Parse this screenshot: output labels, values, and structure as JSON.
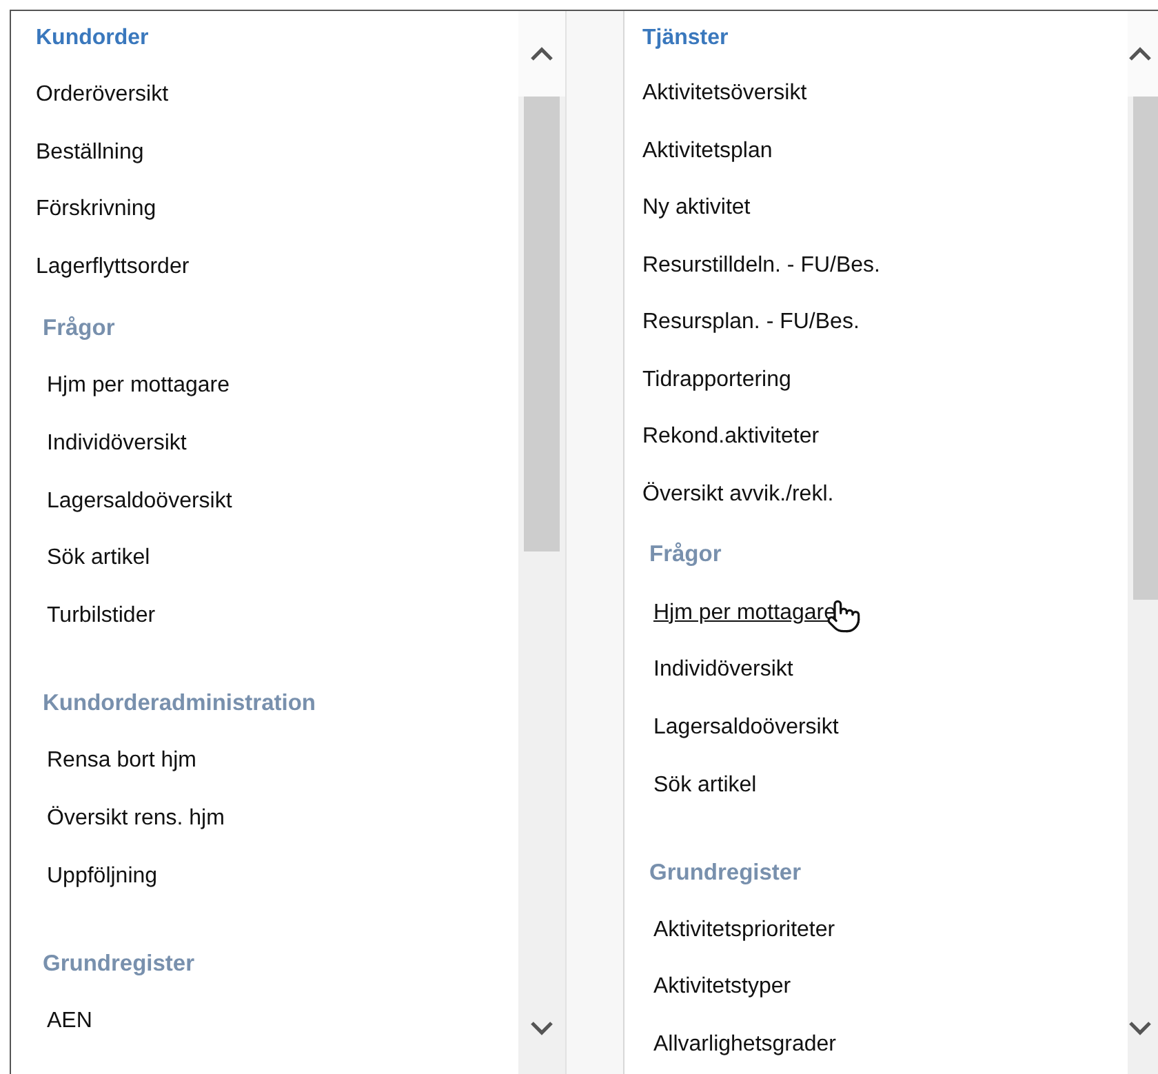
{
  "panels": [
    {
      "title": "Kundorder",
      "items": [
        {
          "label": "Orderöversikt",
          "hovered": false
        },
        {
          "label": "Beställning",
          "hovered": false
        },
        {
          "label": "Förskrivning",
          "hovered": false
        },
        {
          "label": "Lagerflyttsorder",
          "hovered": false
        }
      ],
      "groups": [
        {
          "title": "Frågor",
          "items": [
            {
              "label": "Hjm per mottagare",
              "hovered": false
            },
            {
              "label": "Individöversikt",
              "hovered": false
            },
            {
              "label": "Lagersaldoöversikt",
              "hovered": false
            },
            {
              "label": "Sök artikel",
              "hovered": false
            },
            {
              "label": "Turbilstider",
              "hovered": false
            }
          ]
        },
        {
          "title": "Kundorderadministration",
          "items": [
            {
              "label": "Rensa bort hjm",
              "hovered": false
            },
            {
              "label": "Översikt rens. hjm",
              "hovered": false
            },
            {
              "label": "Uppföljning",
              "hovered": false
            }
          ]
        },
        {
          "title": "Grundregister",
          "items": [
            {
              "label": "AEN",
              "hovered": false
            }
          ]
        }
      ]
    },
    {
      "title": "Tjänster",
      "items": [
        {
          "label": "Aktivitetsöversikt",
          "hovered": false
        },
        {
          "label": "Aktivitetsplan",
          "hovered": false
        },
        {
          "label": "Ny aktivitet",
          "hovered": false
        },
        {
          "label": "Resurstilldeln. - FU/Bes.",
          "hovered": false
        },
        {
          "label": "Resursplan. - FU/Bes.",
          "hovered": false
        },
        {
          "label": "Tidrapportering",
          "hovered": false
        },
        {
          "label": "Rekond.aktiviteter",
          "hovered": false
        },
        {
          "label": "Översikt avvik./rekl.",
          "hovered": false
        }
      ],
      "groups": [
        {
          "title": "Frågor",
          "items": [
            {
              "label": "Hjm per mottagare",
              "hovered": true
            },
            {
              "label": "Individöversikt",
              "hovered": false
            },
            {
              "label": "Lagersaldoöversikt",
              "hovered": false
            },
            {
              "label": "Sök artikel",
              "hovered": false
            }
          ]
        },
        {
          "title": "Grundregister",
          "items": [
            {
              "label": "Aktivitetsprioriteter",
              "hovered": false
            },
            {
              "label": "Aktivitetstyper",
              "hovered": false
            },
            {
              "label": "Allvarlighetsgrader",
              "hovered": false
            }
          ]
        }
      ]
    }
  ]
}
